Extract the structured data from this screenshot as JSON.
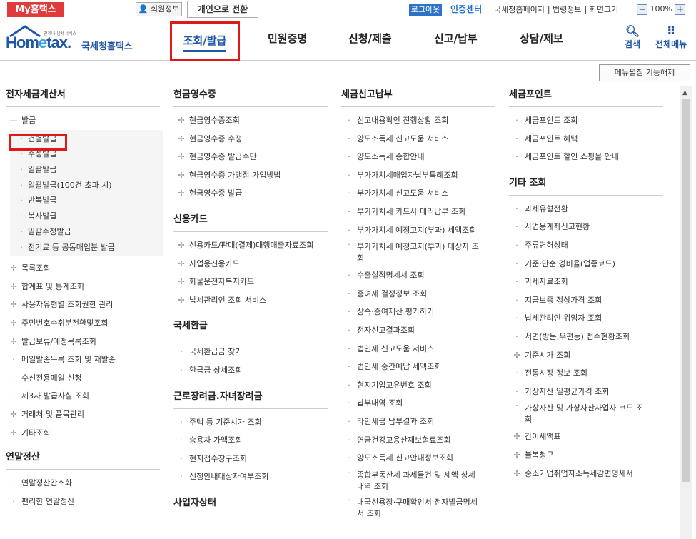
{
  "topbar": {
    "brand": "My홈택스",
    "member": "회원정보",
    "switch": "개인으로 전환",
    "logout": "로그아웃",
    "cert": "인증센터",
    "links": [
      "국세청홈페이지",
      "법령정보",
      "화면크기"
    ],
    "zoom": "100%"
  },
  "header": {
    "logo_small": "언제나 납세서비스",
    "logo_home": "Hom",
    "logo_e": "e",
    "logo_tax": "tax.",
    "logo_kr": "국세청홈택스",
    "nav": [
      "조회/발급",
      "민원증명",
      "신청/제출",
      "신고/납부",
      "상담/제보"
    ],
    "search": "검색",
    "allmenu": "전체메뉴"
  },
  "collapse": "메뉴펼침 기능해제",
  "col1": {
    "title": "전자세금계산서",
    "parent": "발급",
    "subitems": [
      "건별발급",
      "수정발급",
      "일괄발급",
      "일괄발급(100건 초과 시)",
      "반복발급",
      "복사발급",
      "일괄수정발급",
      "전기료 등 공동매입분 발급"
    ],
    "items": [
      {
        "p": "+",
        "t": "목록조회"
      },
      {
        "p": "+",
        "t": "합계표 및 통계조회"
      },
      {
        "p": "+",
        "t": "사용자유형별 조회권한 관리"
      },
      {
        "p": "+",
        "t": "주민번호수취분전환및조회"
      },
      {
        "p": "+",
        "t": "발급보류/예정목록조회"
      },
      {
        "p": "·",
        "t": "메일발송목록 조회 및 재발송"
      },
      {
        "p": "·",
        "t": "수신전용메일 신청"
      },
      {
        "p": "·",
        "t": "제3자 발급사실 조회"
      },
      {
        "p": "+",
        "t": "거래처 및 품목관리"
      },
      {
        "p": "+",
        "t": "기타조회"
      }
    ],
    "title2": "연말정산",
    "items2": [
      "연말정산간소화",
      "편리한 연말정산"
    ]
  },
  "col2": {
    "sections": [
      {
        "title": "현금영수증",
        "items": [
          "현금영수증조회",
          "현금영수증 수정",
          "현금영수증 발급수단",
          "현금영수증 가맹점 가입방법",
          "현금영수증 발급"
        ],
        "pfx": "+"
      },
      {
        "title": "신용카드",
        "items": [
          "신용카드/판매(결제)대행매출자료조회",
          "사업용신용카드",
          "화물운전자복지카드",
          "납세관리인 조회 서비스"
        ],
        "pfx": "+"
      },
      {
        "title": "국세환급",
        "items": [
          "국세환급금 찾기",
          "환급금 상세조회"
        ],
        "pfx": "·"
      },
      {
        "title": "근로장려금.자녀장려금",
        "items": [
          "주택 등 기준시가 조회",
          "승용차 가액조회",
          "현지접수창구조회",
          "신청안내대상자여부조회"
        ],
        "pfx": "·"
      },
      {
        "title": "사업자상태",
        "items": [],
        "pfx": "·"
      }
    ]
  },
  "col3": {
    "title": "세금신고납부",
    "items": [
      "신고내용확인 진행상황 조회",
      "양도소득세 신고도움 서비스",
      "양도소득세 종합안내",
      "부가가치세매입자납부특례조회",
      "부가가치세 신고도움 서비스",
      "부가가치세 카드사 대리납부 조회",
      "부가가치세 예정고지(부과) 세액조회",
      "부가가치세 예정고지(부과) 대상자 조|회",
      "수출실적명세서 조회",
      "증여세 결정정보 조회",
      "상속·증여재산 평가하기",
      "전자신고결과조회",
      "법인세 신고도움 서비스",
      "법인세 중간예납 세액조회",
      "현지기업고유번호 조회",
      "납부내역 조회",
      "타인세금 납부결과 조회",
      "연금건강고용산재보험료조회",
      "양도소득세 신고안내정보조회",
      "종합부동산세 과세물건 및 세액 상세|내역 조회",
      "내국신용장·구매확인서 전자발급명세|서 조회"
    ]
  },
  "col4": {
    "title": "세금포인트",
    "items": [
      "세금포인트 조회",
      "세금포인트 혜택",
      "세금포인트 할인 쇼핑몰 안내"
    ],
    "title2": "기타 조회",
    "items2": [
      {
        "p": "·",
        "t": "과세유형전환"
      },
      {
        "p": "·",
        "t": "사업용계좌신고현황"
      },
      {
        "p": "·",
        "t": "주류면허상태"
      },
      {
        "p": "·",
        "t": "기준·단순 경비율(업종코드)"
      },
      {
        "p": "·",
        "t": "과세자료조회"
      },
      {
        "p": "·",
        "t": "지급보증 정상가격 조회"
      },
      {
        "p": "·",
        "t": "납세관리인 위임자 조회"
      },
      {
        "p": "·",
        "t": "서면(방문,우편등) 접수현황조회"
      },
      {
        "p": "+",
        "t": "기준시가 조회"
      },
      {
        "p": "·",
        "t": "전통시장 정보 조회"
      },
      {
        "p": "·",
        "t": "가상자산 일평균가격 조회"
      },
      {
        "p": "·",
        "t": "가상자산 및 가상자산사업자 코드 조|회"
      },
      {
        "p": "+",
        "t": "간이세액표"
      },
      {
        "p": "+",
        "t": "불복청구"
      },
      {
        "p": "+",
        "t": "중소기업취업자소득세감면명세서"
      }
    ]
  }
}
